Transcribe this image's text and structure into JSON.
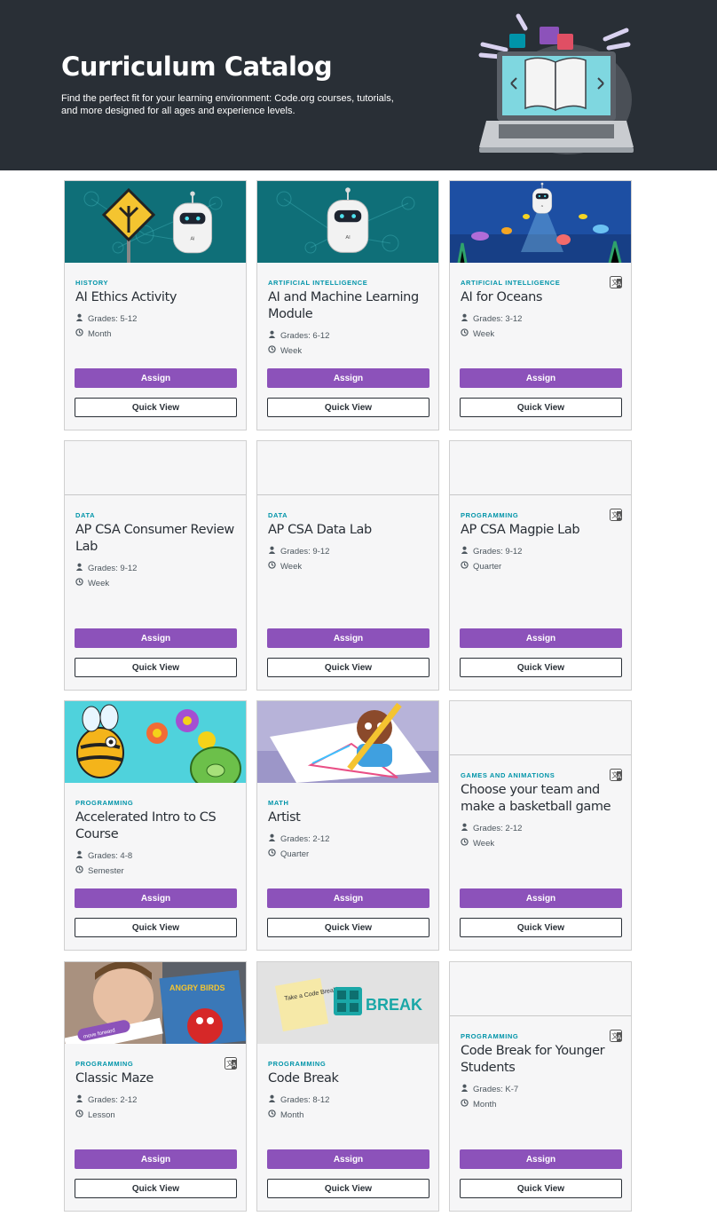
{
  "hero": {
    "title": "Curriculum Catalog",
    "subtitle": "Find the perfect fit for your learning environment: Code.org courses, tutorials, and more designed for all ages and experience levels."
  },
  "labels": {
    "assign": "Assign",
    "quick_view": "Quick View"
  },
  "colors": {
    "hero_bg": "#292f36",
    "topic": "#0094a9",
    "assign_bg": "#8c52ba"
  },
  "cards": [
    {
      "topic": "HISTORY",
      "title": "AI Ethics Activity",
      "grades": "Grades: 5-12",
      "duration": "Month"
    },
    {
      "topic": "ARTIFICIAL INTELLIGENCE",
      "title": "AI and Machine Learning Module",
      "grades": "Grades: 6-12",
      "duration": "Week"
    },
    {
      "topic": "ARTIFICIAL INTELLIGENCE",
      "title": "AI for Oceans",
      "grades": "Grades: 3-12",
      "duration": "Week"
    },
    {
      "topic": "DATA",
      "title": "AP CSA Consumer Review Lab",
      "grades": "Grades: 9-12",
      "duration": "Week"
    },
    {
      "topic": "DATA",
      "title": "AP CSA Data Lab",
      "grades": "Grades: 9-12",
      "duration": "Week"
    },
    {
      "topic": "PROGRAMMING",
      "title": "AP CSA Magpie Lab",
      "grades": "Grades: 9-12",
      "duration": "Quarter"
    },
    {
      "topic": "PROGRAMMING",
      "title": "Accelerated Intro to CS Course",
      "grades": "Grades: 4-8",
      "duration": "Semester"
    },
    {
      "topic": "MATH",
      "title": "Artist",
      "grades": "Grades: 2-12",
      "duration": "Quarter"
    },
    {
      "topic": "GAMES AND ANIMATIONS",
      "title": "Choose your team and make a basketball game",
      "grades": "Grades: 2-12",
      "duration": "Week"
    },
    {
      "topic": "PROGRAMMING",
      "title": "Classic Maze",
      "grades": "Grades: 2-12",
      "duration": "Lesson"
    },
    {
      "topic": "PROGRAMMING",
      "title": "Code Break",
      "grades": "Grades: 8-12",
      "duration": "Month"
    },
    {
      "topic": "PROGRAMMING",
      "title": "Code Break for Younger Students",
      "grades": "Grades: K-7",
      "duration": "Month"
    }
  ],
  "thumbnail_text": {
    "ai_badge": "AI",
    "move_forward": "move forward",
    "angry_birds": "ANGRY BIRDS",
    "take_a_code_break": "Take a Code Break!",
    "break_logo": "BREAK"
  }
}
